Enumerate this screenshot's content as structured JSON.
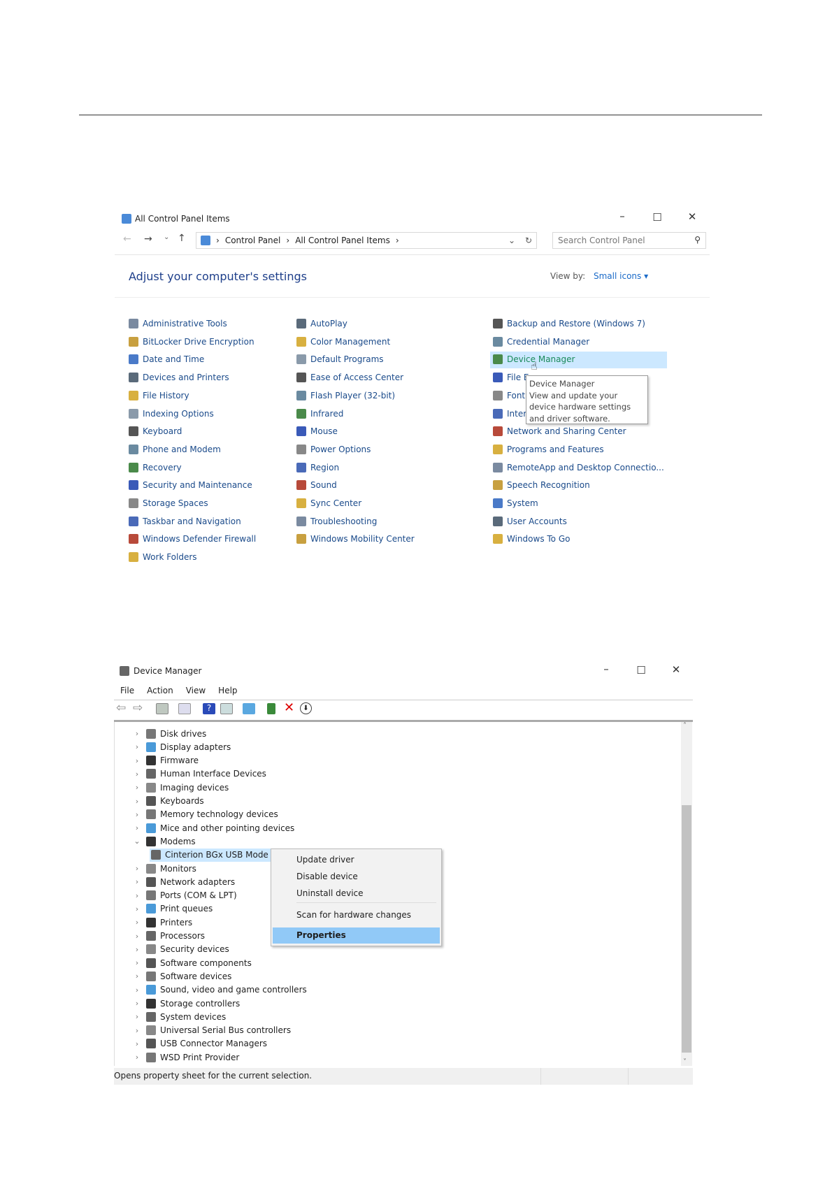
{
  "control_panel": {
    "title": "All Control Panel Items",
    "address": [
      "Control Panel",
      "All Control Panel Items"
    ],
    "search_placeholder": "Search Control Panel",
    "heading": "Adjust your computer's settings",
    "view_by_label": "View by:",
    "view_by_value": "Small icons",
    "items": [
      [
        "Administrative Tools",
        "BitLocker Drive Encryption",
        "Date and Time",
        "Devices and Printers",
        "File History",
        "Indexing Options",
        "Keyboard",
        "Phone and Modem",
        "Recovery",
        "Security and Maintenance",
        "Storage Spaces",
        "Taskbar and Navigation",
        "Windows Defender Firewall",
        "Work Folders"
      ],
      [
        "AutoPlay",
        "Color Management",
        "Default Programs",
        "Ease of Access Center",
        "Flash Player (32-bit)",
        "Infrared",
        "Mouse",
        "Power Options",
        "Region",
        "Sound",
        "Sync Center",
        "Troubleshooting",
        "Windows Mobility Center"
      ],
      [
        "Backup and Restore (Windows 7)",
        "Credential Manager",
        "Device Manager",
        "File E",
        "Font",
        "Inter",
        "Network and Sharing Center",
        "Programs and Features",
        "RemoteApp and Desktop Connectio...",
        "Speech Recognition",
        "System",
        "User Accounts",
        "Windows To Go"
      ]
    ],
    "icon_colors": [
      "#7a8aa0",
      "#c8a040",
      "#4a7ac8",
      "#5a6a7a",
      "#d8b040",
      "#8a9aaa",
      "#555",
      "#6a8aa0",
      "#4a8a4a",
      "#3a5ab8",
      "#888",
      "#4a6ab8",
      "#b84a3a",
      "#d8b040"
    ],
    "tooltip": {
      "title": "Device Manager",
      "body": "View and update your device hardware settings and driver software."
    }
  },
  "device_manager": {
    "title": "Device Manager",
    "menu": [
      "File",
      "Action",
      "View",
      "Help"
    ],
    "tree": [
      {
        "label": "Disk drives",
        "exp": "›"
      },
      {
        "label": "Display adapters",
        "exp": "›"
      },
      {
        "label": "Firmware",
        "exp": "›"
      },
      {
        "label": "Human Interface Devices",
        "exp": "›"
      },
      {
        "label": "Imaging devices",
        "exp": "›"
      },
      {
        "label": "Keyboards",
        "exp": "›"
      },
      {
        "label": "Memory technology devices",
        "exp": "›"
      },
      {
        "label": "Mice and other pointing devices",
        "exp": "›"
      },
      {
        "label": "Modems",
        "exp": "⌄"
      },
      {
        "label": "Cinterion BGx USB Mode",
        "exp": "",
        "child": true
      },
      {
        "label": "Monitors",
        "exp": "›"
      },
      {
        "label": "Network adapters",
        "exp": "›"
      },
      {
        "label": "Ports (COM & LPT)",
        "exp": "›"
      },
      {
        "label": "Print queues",
        "exp": "›"
      },
      {
        "label": "Printers",
        "exp": "›"
      },
      {
        "label": "Processors",
        "exp": "›"
      },
      {
        "label": "Security devices",
        "exp": "›"
      },
      {
        "label": "Software components",
        "exp": "›"
      },
      {
        "label": "Software devices",
        "exp": "›"
      },
      {
        "label": "Sound, video and game controllers",
        "exp": "›"
      },
      {
        "label": "Storage controllers",
        "exp": "›"
      },
      {
        "label": "System devices",
        "exp": "›"
      },
      {
        "label": "Universal Serial Bus controllers",
        "exp": "›"
      },
      {
        "label": "USB Connector Managers",
        "exp": "›"
      },
      {
        "label": "WSD Print Provider",
        "exp": "›"
      }
    ],
    "context_menu": [
      "Update driver",
      "Disable device",
      "Uninstall device",
      "Scan for hardware changes",
      "Properties"
    ],
    "status": "Opens property sheet for the current selection."
  },
  "colors": {
    "link": "#1a4a8a",
    "heading": "#1e3f8a",
    "highlight": "#cce8ff",
    "menu_highlight": "#91c9f7"
  }
}
